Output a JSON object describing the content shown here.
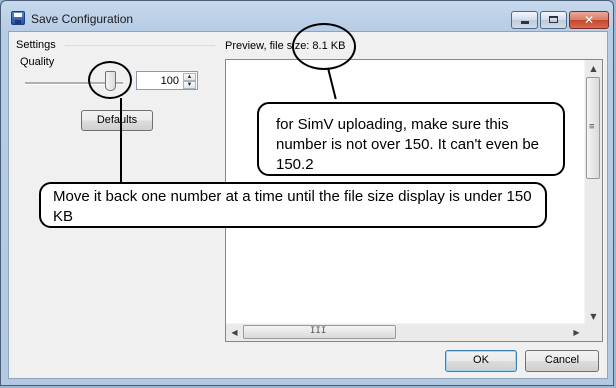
{
  "window": {
    "title": "Save Configuration"
  },
  "settings": {
    "group_label": "Settings",
    "quality_label": "Quality",
    "quality_value": "100",
    "quality_slider_level": 1.0,
    "defaults_button": "Defaults"
  },
  "preview": {
    "label": "Preview, file size: 8.1 KB",
    "hscroll_grip": "III"
  },
  "footer": {
    "ok_button": "OK",
    "cancel_button": "Cancel"
  },
  "annotations": {
    "callout_simv": "for SimV uploading, make sure this number is not over 150. It can't even be 150.2",
    "callout_move": "Move it back one number at a time until the file size display is under 150 KB"
  },
  "icons": {
    "app": "save-disk-icon",
    "minimize": "minimize-icon",
    "maximize": "maximize-icon",
    "close": "close-icon"
  }
}
